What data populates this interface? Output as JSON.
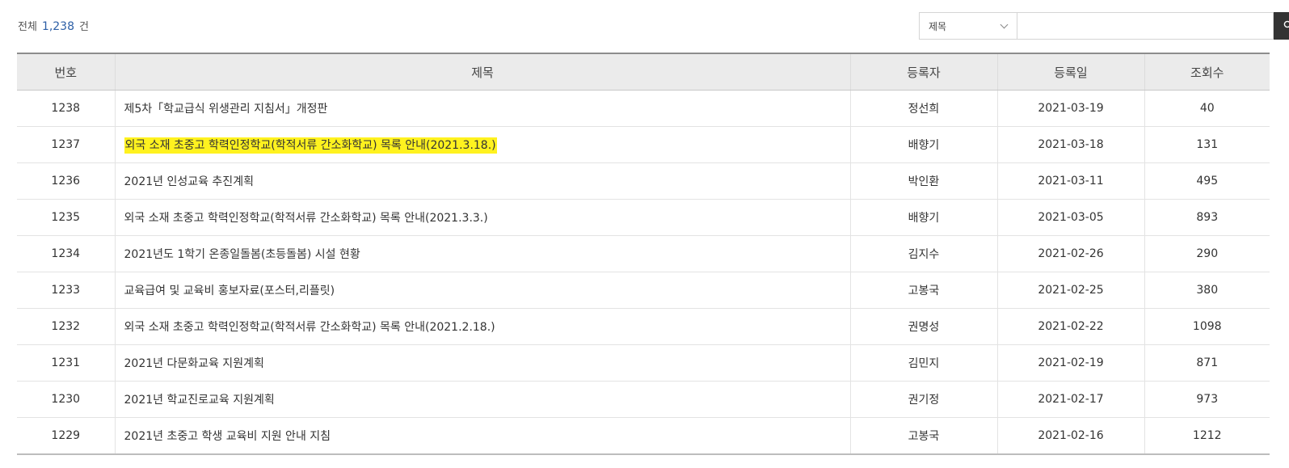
{
  "summary": {
    "prefix": "전체",
    "count": "1,238",
    "suffix": "건"
  },
  "search": {
    "select_value": "제목",
    "input_value": "",
    "button_icon": "search-icon"
  },
  "table": {
    "headers": [
      "번호",
      "제목",
      "등록자",
      "등록일",
      "조회수"
    ],
    "rows": [
      {
        "no": "1238",
        "title": "제5차「학교급식 위생관리 지침서」개정판",
        "author": "정선희",
        "date": "2021-03-19",
        "views": "40"
      },
      {
        "no": "1237",
        "title": "외국 소재 초중고 학력인정학교(학적서류 간소화학교) 목록 안내(2021.3.18.)",
        "author": "배향기",
        "date": "2021-03-18",
        "views": "131",
        "highlighted": true
      },
      {
        "no": "1236",
        "title": "2021년 인성교육 추진계획",
        "author": "박인환",
        "date": "2021-03-11",
        "views": "495"
      },
      {
        "no": "1235",
        "title": "외국 소재 초중고 학력인정학교(학적서류 간소화학교) 목록 안내(2021.3.3.)",
        "author": "배향기",
        "date": "2021-03-05",
        "views": "893"
      },
      {
        "no": "1234",
        "title": "2021년도 1학기 온종일돌봄(초등돌봄) 시설 현황",
        "author": "김지수",
        "date": "2021-02-26",
        "views": "290"
      },
      {
        "no": "1233",
        "title": "교육급여 및 교육비 홍보자료(포스터,리플릿)",
        "author": "고봉국",
        "date": "2021-02-25",
        "views": "380"
      },
      {
        "no": "1232",
        "title": "외국 소재 초중고 학력인정학교(학적서류 간소화학교) 목록 안내(2021.2.18.)",
        "author": "권명성",
        "date": "2021-02-22",
        "views": "1098"
      },
      {
        "no": "1231",
        "title": "2021년 다문화교육 지원계획",
        "author": "김민지",
        "date": "2021-02-19",
        "views": "871"
      },
      {
        "no": "1230",
        "title": "2021년 학교진로교육 지원계획",
        "author": "권기정",
        "date": "2021-02-17",
        "views": "973"
      },
      {
        "no": "1229",
        "title": "2021년 초중고 학생 교육비 지원 안내 지침",
        "author": "고봉국",
        "date": "2021-02-16",
        "views": "1212"
      }
    ]
  },
  "colors": {
    "count_accent": "#2d5fa6",
    "highlight": "#fff21f",
    "search_button_bg": "#333333",
    "header_bg": "#ebebeb"
  }
}
